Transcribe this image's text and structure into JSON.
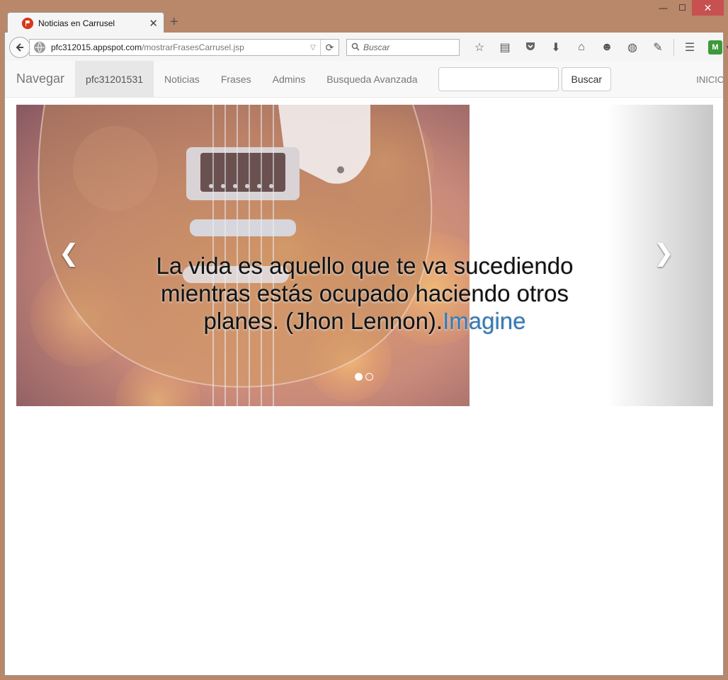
{
  "window": {
    "controls": {
      "minimize": "—",
      "maximize": "☐",
      "close": "✕"
    }
  },
  "tab": {
    "title": "Noticias en Carrusel",
    "favicon": "PFC",
    "close": "✕",
    "new_tab": "+"
  },
  "toolbar": {
    "url_host": "pfc312015.appspot.com",
    "url_path": "/mostrarFrasesCarrusel.jsp",
    "search_placeholder": "Buscar",
    "icons": [
      "star-icon",
      "reading-list-icon",
      "pocket-icon",
      "download-icon",
      "home-icon",
      "emoji-icon",
      "globe-icon",
      "pencil-icon",
      "menu-icon",
      "addon-icon"
    ]
  },
  "navbar": {
    "brand": "Navegar",
    "items": [
      {
        "label": "pfc31201531",
        "active": true
      },
      {
        "label": "Noticias",
        "active": false
      },
      {
        "label": "Frases",
        "active": false
      },
      {
        "label": "Admins",
        "active": false
      },
      {
        "label": "Busqueda Avanzada",
        "active": false
      }
    ],
    "search_value": "",
    "search_button": "Buscar",
    "right_link": "INICIO"
  },
  "carousel": {
    "caption_text": "La vida es aquello que te va sucediendo mientras estás ocupado haciendo otros planes. (Jhon Lennon).",
    "caption_link": "Imagine",
    "slides_total": 2,
    "active_slide": 1
  },
  "colors": {
    "link": "#337ab7",
    "navbar_bg": "#f8f8f8",
    "frame": "#b9876a"
  }
}
